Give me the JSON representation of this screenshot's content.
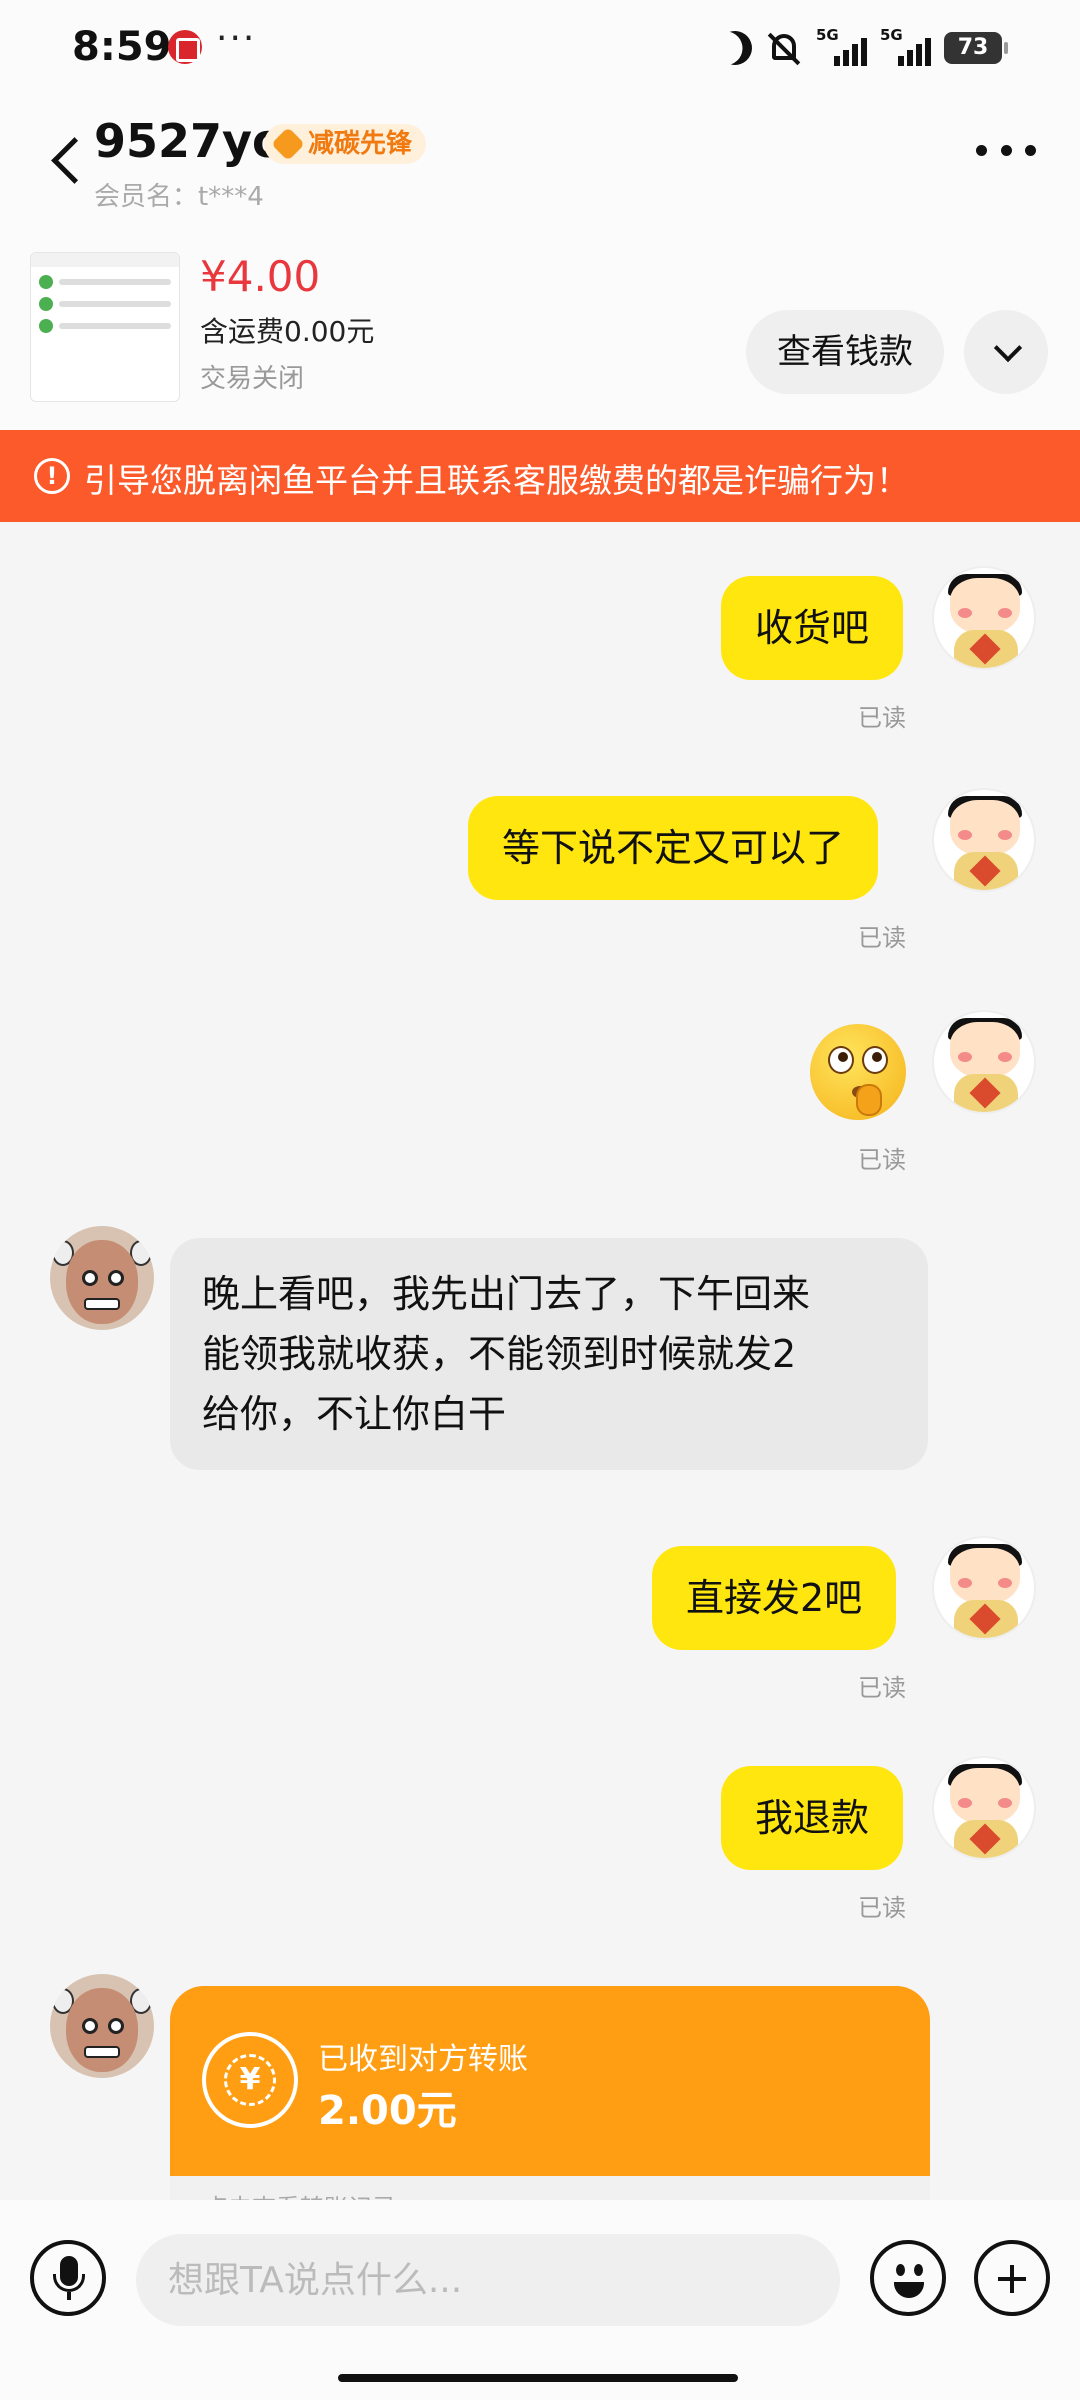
{
  "status_bar": {
    "time": "8:59",
    "more": "···",
    "sig1": "5G",
    "sig2": "5G",
    "battery": "73"
  },
  "header": {
    "nickname": "9527yo",
    "badge": "减碳先锋",
    "member": "会员名：t***4"
  },
  "product": {
    "price": "¥4.00",
    "shipping": "含运费0.00元",
    "status": "交易关闭",
    "view_button": "查看钱款"
  },
  "warning": {
    "icon": "!",
    "text": "引导您脱离闲鱼平台并且联系客服缴费的都是诈骗行为！"
  },
  "messages": {
    "m1": {
      "text": "收货吧",
      "read": "已读"
    },
    "m2": {
      "text": "等下说不定又可以了",
      "read": "已读"
    },
    "m3": {
      "emoji": "thinking-face-emoji",
      "read": "已读"
    },
    "m4": {
      "lines": [
        "晚上看吧，我先出门去了，下午回来",
        "能领我就收获，不能领到时候就发2",
        "给你，不让你白干"
      ]
    },
    "m5": {
      "text": "直接发2吧",
      "read": "已读"
    },
    "m6": {
      "text": "我退款",
      "read": "已读"
    },
    "transfer": {
      "title": "已收到对方转账",
      "amount": "2.00元",
      "footer": "点击查看转账记录",
      "icon": "¥"
    }
  },
  "input": {
    "placeholder": "想跟TA说点什么..."
  },
  "colors": {
    "my_bubble": "#ffe60f",
    "their_bubble": "#e9e9e9",
    "warning_bg": "#fc5a2a",
    "price": "#e8383d",
    "transfer_card": "#ff9d13"
  }
}
